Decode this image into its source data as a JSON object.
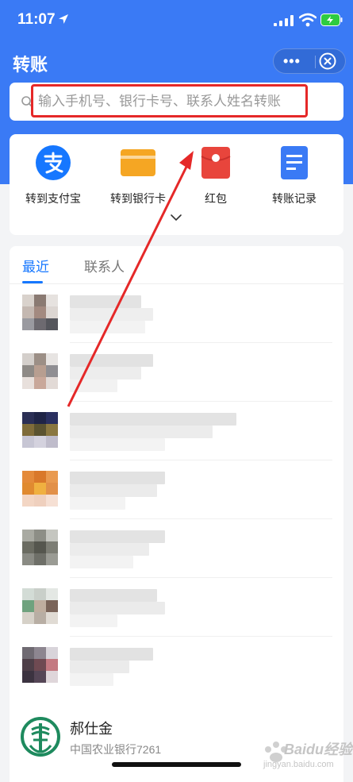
{
  "status_bar": {
    "time": "11:07"
  },
  "header": {
    "title": "转账",
    "more_label": "•••"
  },
  "search": {
    "placeholder": "输入手机号、银行卡号、联系人姓名转账"
  },
  "actions": [
    {
      "label": "转到支付宝",
      "icon": "alipay-icon",
      "color": "#1677ff"
    },
    {
      "label": "转到银行卡",
      "icon": "bank-card-icon",
      "color": "#f5a623"
    },
    {
      "label": "红包",
      "icon": "red-packet-icon",
      "color": "#e8453c"
    },
    {
      "label": "转账记录",
      "icon": "transfer-record-icon",
      "color": "#3a7af5"
    }
  ],
  "tabs": {
    "recent": "最近",
    "contacts": "联系人"
  },
  "bank_contact": {
    "name": "郝仕金",
    "detail": "中国农业银行7261"
  },
  "watermark": {
    "text": "Baidu经验",
    "url": "jingyan.baidu.com"
  },
  "colors": {
    "primary": "#3a7af5",
    "highlight": "#e52828",
    "abc_green": "#1e8a5e"
  }
}
